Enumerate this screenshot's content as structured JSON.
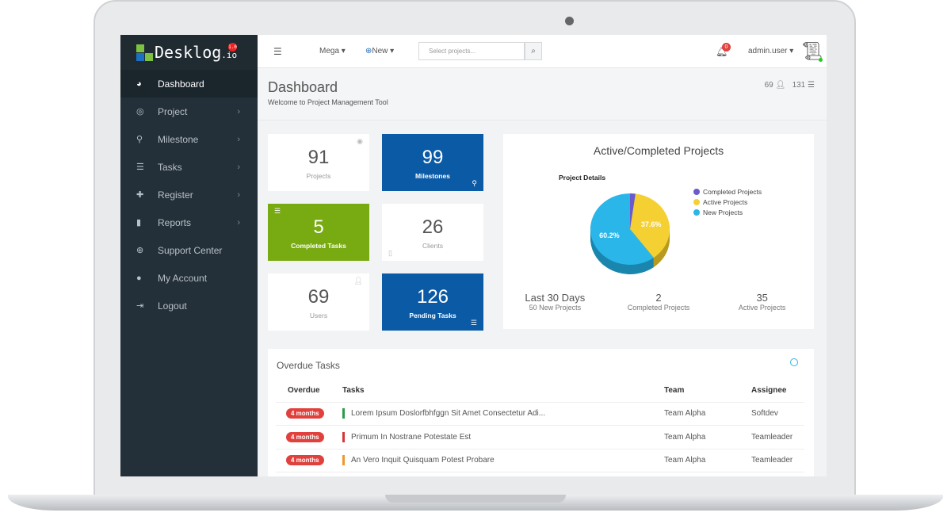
{
  "brand": {
    "name": "Desklog",
    "suffix": ".io",
    "version": "1.0"
  },
  "sidebar": {
    "items": [
      {
        "label": "Dashboard",
        "icon": "dashboard-icon",
        "glyph": "◕",
        "chevron": false
      },
      {
        "label": "Project",
        "icon": "target-icon",
        "glyph": "◎",
        "chevron": true
      },
      {
        "label": "Milestone",
        "icon": "map-marker-icon",
        "glyph": "⚲",
        "chevron": true
      },
      {
        "label": "Tasks",
        "icon": "list-icon",
        "glyph": "☰",
        "chevron": true
      },
      {
        "label": "Register",
        "icon": "plus-icon",
        "glyph": "✚",
        "chevron": true
      },
      {
        "label": "Reports",
        "icon": "bar-chart-icon",
        "glyph": "▮",
        "chevron": true
      },
      {
        "label": "Support Center",
        "icon": "lifebuoy-icon",
        "glyph": "⊕",
        "chevron": false
      },
      {
        "label": "My Account",
        "icon": "user-icon",
        "glyph": "●",
        "chevron": false
      },
      {
        "label": "Logout",
        "icon": "logout-icon",
        "glyph": "⇥",
        "chevron": false
      }
    ]
  },
  "topbar": {
    "mega": "Mega",
    "new": "New",
    "search_placeholder": "Select projects...",
    "notifications": "0",
    "user": "admin.user"
  },
  "header": {
    "title": "Dashboard",
    "subtitle": "Welcome to Project Management Tool",
    "users_count": "69",
    "tasks_count": "131"
  },
  "cards": [
    {
      "value": "91",
      "label": "Projects",
      "style": "white"
    },
    {
      "value": "99",
      "label": "Milestones",
      "style": "blue"
    },
    {
      "value": "5",
      "label": "Completed Tasks",
      "style": "green"
    },
    {
      "value": "26",
      "label": "Clients",
      "style": "white"
    },
    {
      "value": "69",
      "label": "Users",
      "style": "white"
    },
    {
      "value": "126",
      "label": "Pending Tasks",
      "style": "blue"
    }
  ],
  "chart_panel": {
    "title": "Active/Completed Projects",
    "stats": [
      {
        "value": "Last 30 Days",
        "label": "50 New Projects"
      },
      {
        "value": "2",
        "label": "Completed Projects"
      },
      {
        "value": "35",
        "label": "Active Projects"
      }
    ]
  },
  "chart_data": {
    "type": "pie",
    "title": "Project Details",
    "slices": [
      {
        "name": "Completed Projects",
        "value": 2.2,
        "color": "#6a5acd"
      },
      {
        "name": "Active Projects",
        "value": 37.6,
        "color": "#f5d033",
        "label": "37.6%"
      },
      {
        "name": "New Projects",
        "value": 60.2,
        "color": "#2ab6e8",
        "label": "60.2%"
      }
    ],
    "legend": "right"
  },
  "overdue": {
    "title": "Overdue Tasks",
    "columns": [
      "Overdue",
      "Tasks",
      "Team",
      "Assignee"
    ],
    "rows": [
      {
        "overdue": "4 months",
        "task": "Lorem Ipsum Doslorfbhfggn Sit Amet Consectetur Adi...",
        "team": "Team Alpha",
        "assignee": "Softdev",
        "color": "#2e9b4c"
      },
      {
        "overdue": "4 months",
        "task": "Primum In Nostrane Potestate Est",
        "team": "Team Alpha",
        "assignee": "Teamleader",
        "color": "#d9343a"
      },
      {
        "overdue": "4 months",
        "task": "An Vero Inquit Quisquam Potest Probare",
        "team": "Team Alpha",
        "assignee": "Teamleader",
        "color": "#f0962e"
      }
    ]
  }
}
